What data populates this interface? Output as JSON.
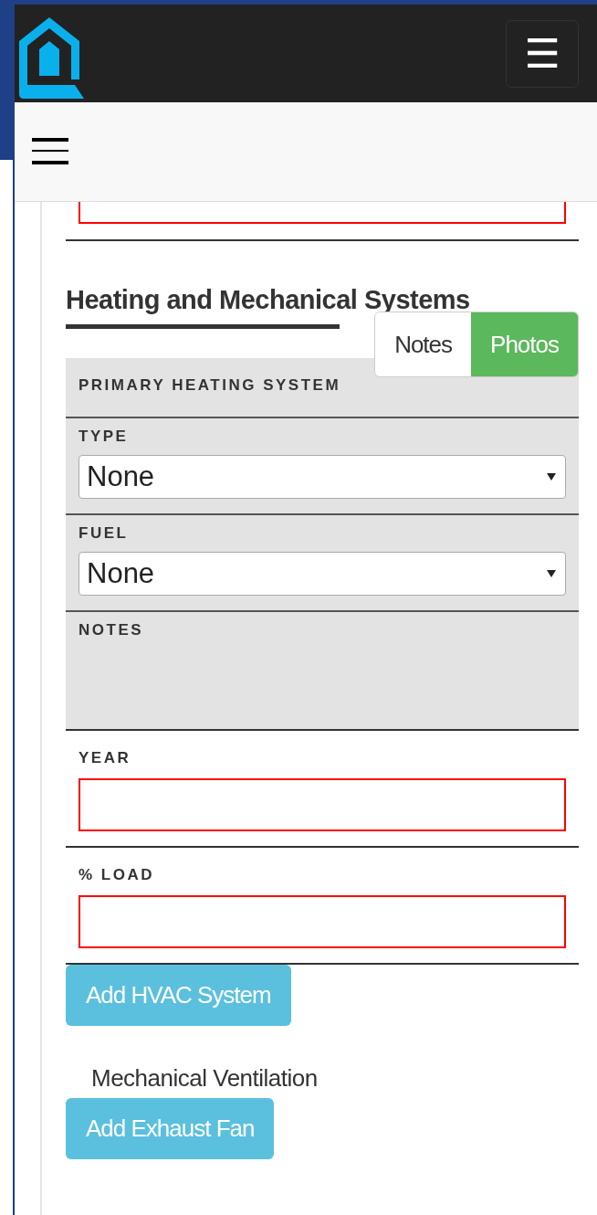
{
  "navbar": {
    "menu_button": "☰"
  },
  "previous_field": {
    "invalid": true
  },
  "section": {
    "title": "Heating and Mechanical Systems",
    "toggle": [
      {
        "label": "Notes",
        "selected": false
      },
      {
        "label": "Photos",
        "selected": true
      }
    ],
    "group_title": "PRIMARY HEATING SYSTEM",
    "group_fields": [
      {
        "kind": "select",
        "label": "TYPE",
        "value": "None"
      },
      {
        "kind": "select",
        "label": "FUEL",
        "value": "None"
      },
      {
        "kind": "notes",
        "label": "NOTES"
      }
    ],
    "fields": [
      {
        "label": "YEAR",
        "invalid": true
      },
      {
        "label": "% LOAD",
        "invalid": true
      }
    ],
    "add_button": "Add HVAC System"
  },
  "ventilation": {
    "title": "Mechanical Ventilation",
    "add_button": "Add Exhaust Fan"
  }
}
